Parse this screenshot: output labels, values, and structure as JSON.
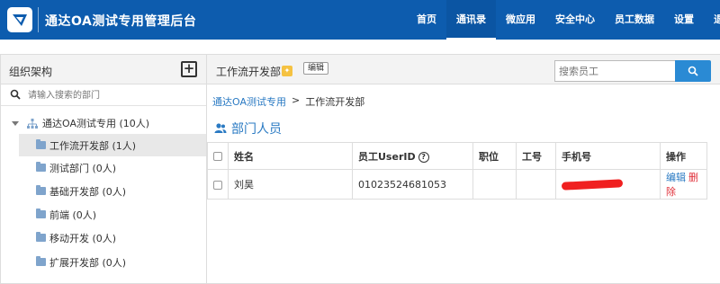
{
  "app": {
    "title": "通达OA测试专用管理后台"
  },
  "nav": {
    "items": [
      "首页",
      "通讯录",
      "微应用",
      "安全中心",
      "员工数据",
      "设置",
      "退出"
    ],
    "active_index": 1
  },
  "left_panel": {
    "title": "组织架构",
    "search_placeholder": "请输入搜索的部门",
    "root": "通达OA测试专用 (10人)",
    "items": [
      "工作流开发部 (1人)",
      "测试部门 (0人)",
      "基础开发部 (0人)",
      "前端 (0人)",
      "移动开发 (0人)",
      "扩展开发部 (0人)"
    ],
    "selected_index": 0
  },
  "right_panel": {
    "dept_name": "工作流开发部",
    "edit_label": "编辑",
    "search_placeholder": "搜索员工",
    "breadcrumb": {
      "root": "通达OA测试专用",
      "separator": ">",
      "current": "工作流开发部"
    },
    "section_title": "部门人员",
    "table": {
      "headers": [
        "姓名",
        "员工UserID",
        "职位",
        "工号",
        "手机号",
        "操作"
      ],
      "rows": [
        {
          "name": "刘昊",
          "userid": "01023524681053",
          "position": "",
          "job_no": "",
          "phone": "",
          "edit": "编辑",
          "delete": "删除"
        }
      ]
    }
  },
  "colors": {
    "topbar": "#0d5cae",
    "link": "#2a7ac3",
    "danger": "#e0303a",
    "badge": "#f5c242"
  }
}
